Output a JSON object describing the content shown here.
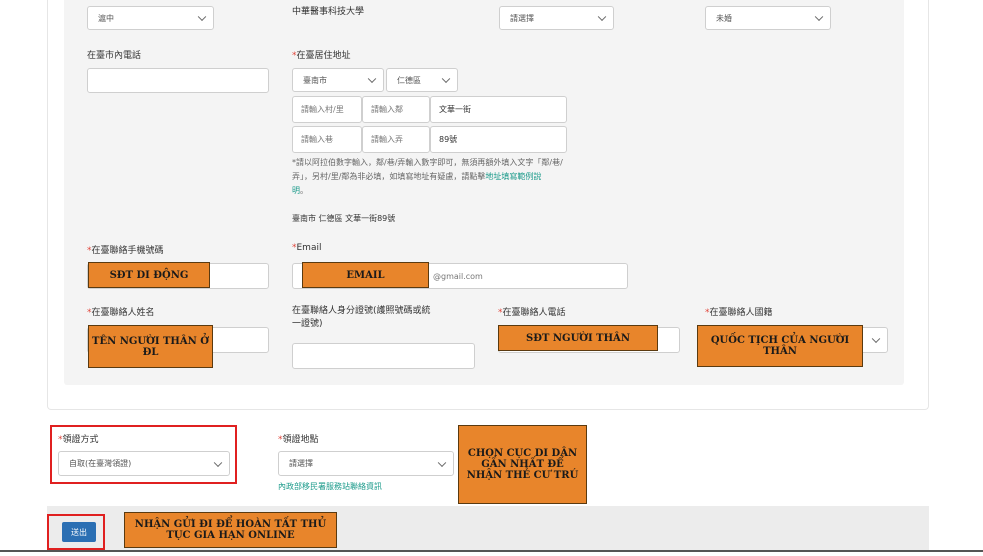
{
  "top_row": {
    "select1_value": "滬中",
    "school_text": "中華醫事科技大學",
    "select2_value": "請選擇",
    "select3_value": "未婚"
  },
  "local_phone": {
    "label": "在臺市內電話",
    "value": ""
  },
  "address": {
    "label": "在臺居住地址",
    "city": "臺南市",
    "district": "仁德區",
    "village_placeholder": "請輸入村/里",
    "neighborhood_placeholder": "請輸入鄰",
    "road": "文華一街",
    "lane_placeholder": "請輸入巷",
    "alley_placeholder": "請輸入弄",
    "number": "89號",
    "note_line1": "*請以阿拉伯數字輸入，鄰/巷/弄輸入數字即可，無須再額外填入文字「鄰/巷/",
    "note_line2": "弄」，另村/里/鄰為非必填，如填寫地址有疑慮，請點擊",
    "note_link": "地址填寫範例說",
    "note_line3": "明",
    "full_address": "臺南市 仁德區 文華一街89號"
  },
  "mobile": {
    "label": "在臺聯絡手機號碼"
  },
  "email": {
    "label": "Email",
    "value": "@gmail.com"
  },
  "contact_name": {
    "label": "在臺聯絡人姓名"
  },
  "contact_id": {
    "label_line1": "在臺聯絡人身分證號(護照號碼或統",
    "label_line2": "一證號)"
  },
  "contact_phone": {
    "label": "在臺聯絡人電話"
  },
  "contact_nationality": {
    "label": "在臺聯絡人國籍"
  },
  "pickup_method": {
    "label": "領證方式",
    "value": "自取(在臺灣領證)"
  },
  "pickup_location": {
    "label": "領證地點",
    "value": "請選擇",
    "note": "內政部移民署服務站聯絡資訊"
  },
  "submit": {
    "label": "送出"
  },
  "annotations": {
    "mobile": "SĐT DI ĐỘNG",
    "email": "EMAIL",
    "contact_name": "TÊN NGƯỜI THÂN Ở ĐL",
    "contact_phone": "SĐT NGƯỜI THÂN",
    "contact_nationality": "QUỐC TỊCH CỦA NGƯỜI THÂN",
    "pickup_location": "CHỌN CỤC DI DÂN GẦN NHẤT ĐỂ NHẬN THẺ CƯ TRÚ",
    "submit": "NHẬN GỬI ĐI ĐỂ HOÀN TẤT THỦ TỤC GIA HẠN ONLINE"
  },
  "colors": {
    "required": "#e0453a",
    "link": "#1a9a8a",
    "annotation_fill": "#e8852b",
    "highlight": "#e02020",
    "submit": "#2b6fb3"
  }
}
